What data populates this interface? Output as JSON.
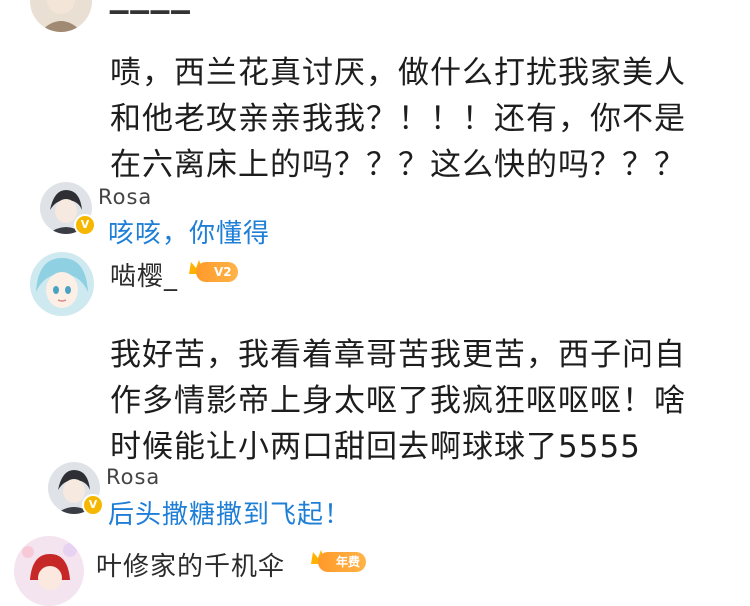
{
  "comments": [
    {
      "text_lines": [
        "啧，西兰花真讨厌，做什么打扰我家美人",
        "和他老攻亲亲我我？！！！还有，你不是",
        "在六离床上的吗？？？这么快的吗？？？"
      ],
      "reply": {
        "user": "Rosa",
        "text": "咳咳，你懂得"
      }
    },
    {
      "user": "啮樱_",
      "level": "V2",
      "text_lines": [
        "我好苦，我看着章哥苦我更苦，西子问自",
        "作多情影帝上身太呕了我疯狂呕呕呕！啥",
        "时候能让小两口甜回去啊球球了5555"
      ],
      "reply": {
        "user": "Rosa",
        "text": "后头撒糖撒到飞起！"
      }
    },
    {
      "user": "叶修家的千机伞",
      "level": "年费"
    }
  ]
}
